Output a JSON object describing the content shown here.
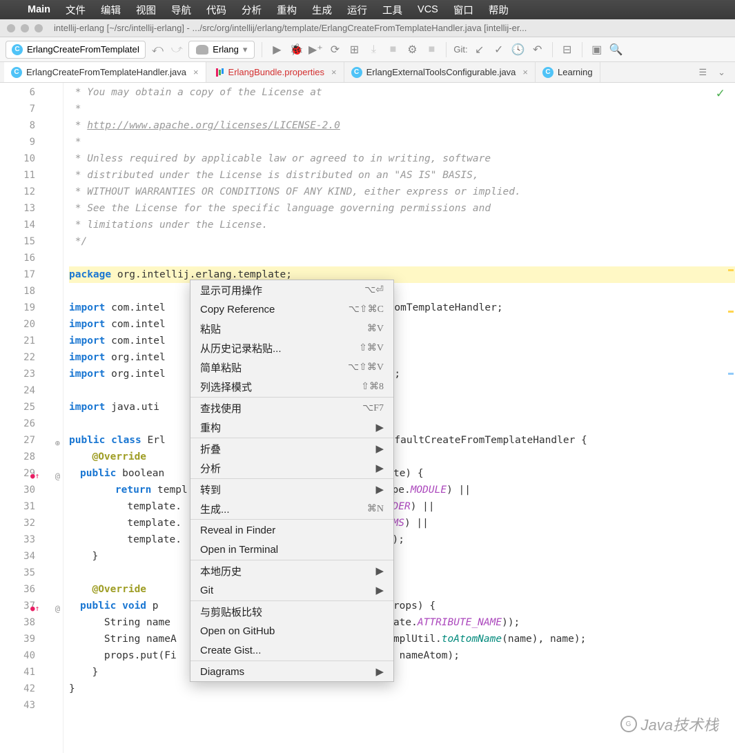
{
  "mac_menu": {
    "app": "Main",
    "items": [
      "文件",
      "编辑",
      "视图",
      "导航",
      "代码",
      "分析",
      "重构",
      "生成",
      "运行",
      "工具",
      "VCS",
      "窗口",
      "帮助"
    ]
  },
  "title": "intellij-erlang [~/src/intellij-erlang] - .../src/org/intellij/erlang/template/ErlangCreateFromTemplateHandler.java [intellij-er...",
  "breadcrumb": "ErlangCreateFromTemplateI",
  "run_config": "Erlang",
  "git_label": "Git:",
  "tabs": [
    {
      "icon": "c",
      "label": "ErlangCreateFromTemplateHandler.java",
      "close": true,
      "active": true
    },
    {
      "icon": "p",
      "label": "ErlangBundle.properties",
      "close": true,
      "red": true
    },
    {
      "icon": "c",
      "label": "ErlangExternalToolsConfigurable.java",
      "close": true
    },
    {
      "icon": "c",
      "label": "Learning",
      "close": false
    }
  ],
  "more_chevron": "⌄",
  "code_lines": [
    {
      "n": "6",
      "cm": " * You may obtain a copy of the License at"
    },
    {
      "n": "7",
      "cm": " *"
    },
    {
      "n": "8",
      "cm": " * ",
      "link": "http://www.apache.org/licenses/LICENSE-2.0"
    },
    {
      "n": "9",
      "cm": " *"
    },
    {
      "n": "10",
      "cm": " * Unless required by applicable law or agreed to in writing, software"
    },
    {
      "n": "11",
      "cm": " * distributed under the License is distributed on an \"AS IS\" BASIS,"
    },
    {
      "n": "12",
      "cm": " * WITHOUT WARRANTIES OR CONDITIONS OF ANY KIND, either express or implied."
    },
    {
      "n": "13",
      "cm": " * See the License for the specific language governing permissions and"
    },
    {
      "n": "14",
      "cm": " * limitations under the License."
    },
    {
      "n": "15",
      "cm": " */"
    },
    {
      "n": "16",
      "txt": ""
    },
    {
      "n": "17",
      "kw": "package",
      "txt": " org.intellij.erlang.template;",
      "hl": true
    },
    {
      "n": "18",
      "txt": ""
    },
    {
      "n": "19",
      "kw": "import",
      "txt": " com.intel                             tCreateFromTemplateHandler;"
    },
    {
      "n": "20",
      "kw": "import",
      "txt": " com.intel                             mplate;"
    },
    {
      "n": "21",
      "kw": "import",
      "txt": " com.intel"
    },
    {
      "n": "22",
      "kw": "import",
      "txt": " org.intel"
    },
    {
      "n": "23",
      "kw": "import",
      "txt": " org.intel                             iImplUtil;"
    },
    {
      "n": "24",
      "txt": ""
    },
    {
      "n": "25",
      "kw": "import",
      "txt": " java.uti"
    },
    {
      "n": "26",
      "txt": ""
    },
    {
      "n": "27",
      "txt": "",
      "mark": "⊕"
    },
    {
      "n": "28",
      "txt": ""
    },
    {
      "n": "29",
      "txt": "",
      "mark": "@",
      "mark2": "●↑"
    },
    {
      "n": "30",
      "txt": ""
    },
    {
      "n": "31",
      "txt": ""
    },
    {
      "n": "32",
      "txt": ""
    },
    {
      "n": "33",
      "txt": ""
    },
    {
      "n": "34",
      "txt": ""
    },
    {
      "n": "35",
      "txt": ""
    },
    {
      "n": "36",
      "txt": ""
    },
    {
      "n": "37",
      "txt": "",
      "mark": "@",
      "mark2": "●↑"
    },
    {
      "n": "38",
      "txt": ""
    },
    {
      "n": "39",
      "txt": ""
    },
    {
      "n": "40",
      "txt": ""
    },
    {
      "n": "41",
      "txt": ""
    },
    {
      "n": "42",
      "txt": ""
    },
    {
      "n": "43",
      "txt": ""
    }
  ],
  "code_html": {
    "l27": {
      "pre": "public class",
      "mid": " Erl                            ",
      "kw2": "extends",
      "post": " DefaultCreateFromTemplateHandler {"
    },
    "l28": {
      "ann": "@Override"
    },
    "l29": {
      "pre": "public",
      "mid": " boolean                              e template) {"
    },
    "l30": {
      "kw": "return",
      "mid": " templ                             ileType.",
      "f": "MODULE",
      "post": ") ||"
    },
    "l31": {
      "mid": "      template.                             pe.",
      "f": "HEADER",
      "post": ") ||"
    },
    "l32": {
      "mid": "      template.                             pe.",
      "f": "TERMS",
      "post": ") ||"
    },
    "l33": {
      "mid": "      template.                             pe.",
      "f": "APP",
      "post": ");"
    },
    "l34": {
      "mid": "  }"
    },
    "l36": {
      "ann": "@Override"
    },
    "l37": {
      "pre": "public void",
      "mid": " p                              Object> props) {"
    },
    "l38": {
      "mid": "    String name                             ileTemplate.",
      "f": "ATTRIBUTE_NAME",
      "post": "));"
    },
    "l39": {
      "mid": "    String nameA                            langPsiImplUtil.",
      "m": "toAtomName",
      "post": "(name), name);"
    },
    "l40": {
      "mid": "    props.put(Fi                            ",
      "s": "\"_ATOM\"",
      "post": ", nameAtom);"
    },
    "l41": {
      "mid": "  }"
    },
    "l42": {
      "mid": "}"
    }
  },
  "context_menu": [
    {
      "label": "显示可用操作",
      "shortcut": "⌥⏎"
    },
    {
      "label": "Copy Reference",
      "shortcut": "⌥⇧⌘C"
    },
    {
      "label": "粘贴",
      "shortcut": "⌘V"
    },
    {
      "label": "从历史记录粘贴...",
      "shortcut": "⇧⌘V"
    },
    {
      "label": "简单粘贴",
      "shortcut": "⌥⇧⌘V"
    },
    {
      "label": "列选择模式",
      "shortcut": "⇧⌘8"
    },
    {
      "sep": true
    },
    {
      "label": "查找使用",
      "shortcut": "⌥F7"
    },
    {
      "label": "重构",
      "submenu": true
    },
    {
      "sep": true
    },
    {
      "label": "折叠",
      "submenu": true
    },
    {
      "label": "分析",
      "submenu": true
    },
    {
      "sep": true
    },
    {
      "label": "转到",
      "submenu": true
    },
    {
      "label": "生成...",
      "shortcut": "⌘N"
    },
    {
      "sep": true
    },
    {
      "label": "Reveal in Finder"
    },
    {
      "label": "Open in Terminal"
    },
    {
      "sep": true
    },
    {
      "label": "本地历史",
      "submenu": true
    },
    {
      "label": "Git",
      "submenu": true
    },
    {
      "sep": true
    },
    {
      "label": "与剪贴板比较"
    },
    {
      "label": "Open on GitHub"
    },
    {
      "label": "Create Gist..."
    },
    {
      "sep": true
    },
    {
      "label": "Diagrams",
      "submenu": true
    }
  ],
  "watermark": "Java技术栈"
}
